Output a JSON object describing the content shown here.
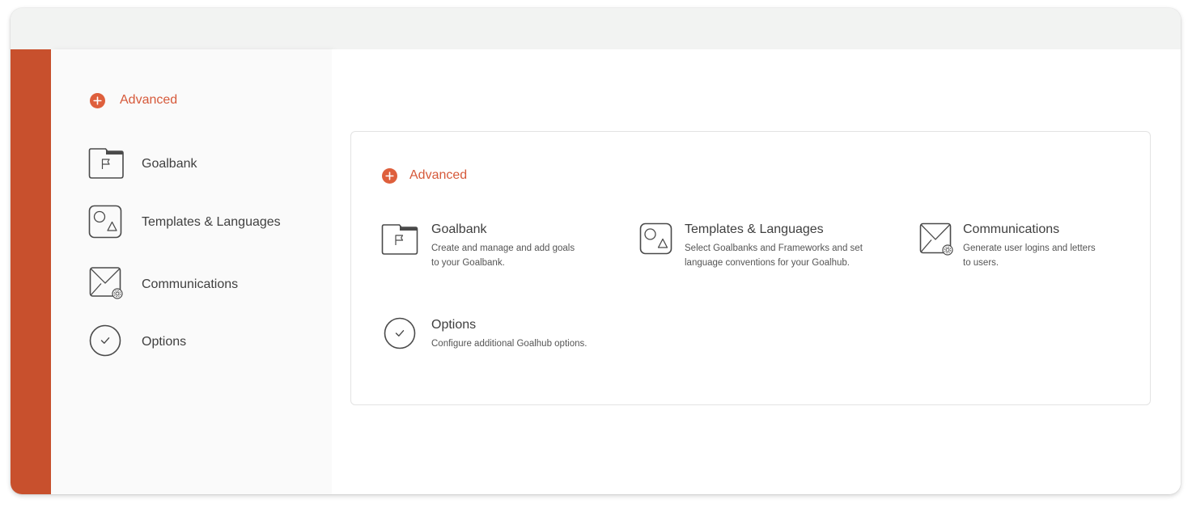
{
  "colors": {
    "accent": "#de5f3c",
    "rail": "#c8502d",
    "text": "#3f3f3f"
  },
  "sidebar": {
    "section_label": "Advanced",
    "items": [
      {
        "label": "Goalbank",
        "icon": "folder-flag-icon"
      },
      {
        "label": "Templates & Languages",
        "icon": "shapes-icon"
      },
      {
        "label": "Communications",
        "icon": "envelope-icon"
      },
      {
        "label": "Options",
        "icon": "check-circle-icon"
      }
    ]
  },
  "main": {
    "section_label": "Advanced",
    "tiles": [
      {
        "title": "Goalbank",
        "icon": "folder-flag-icon",
        "desc": [
          "Create and manage and add goals",
          "to your Goalbank."
        ]
      },
      {
        "title": "Templates & Languages",
        "icon": "shapes-icon",
        "desc": [
          "Select Goalbanks and Frameworks and set",
          "language conventions for your Goalhub."
        ]
      },
      {
        "title": "Communications",
        "icon": "envelope-icon",
        "desc": [
          "Generate user logins and letters",
          "to users."
        ]
      },
      {
        "title": "Options",
        "icon": "check-circle-icon",
        "desc": [
          "Configure additional Goalhub options."
        ]
      }
    ]
  }
}
